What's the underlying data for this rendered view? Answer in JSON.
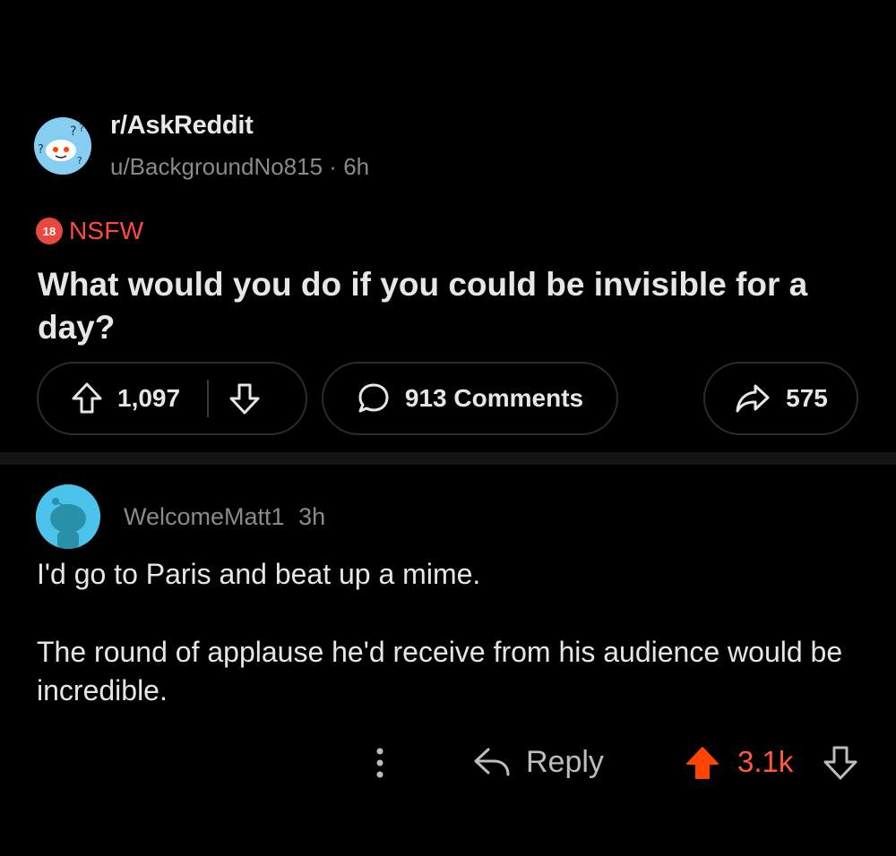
{
  "post": {
    "subreddit": "r/AskReddit",
    "author": "u/BackgroundNo815",
    "meta_separator": "·",
    "age": "6h",
    "nsfw_badge": "18",
    "nsfw_label": "NSFW",
    "title": "What would you do if you could be invisible for a day?",
    "upvotes": "1,097",
    "comments_label": "913 Comments",
    "shares": "575"
  },
  "comment": {
    "author": "WelcomeMatt1",
    "age": "3h",
    "paragraphs": [
      "I'd go to Paris and beat up a mime.",
      "The round of applause he'd receive from his audience would be incredible."
    ],
    "reply_label": "Reply",
    "score": "3.1k"
  },
  "colors": {
    "background": "#000000",
    "accent_nsfw": "#ff4a3d",
    "upvoted": "#ff5a36",
    "muted_text": "#8a8a8a",
    "pill_border": "#2b2b2b"
  },
  "icons": {
    "subreddit_avatar": "askreddit-snoo-icon",
    "upvote": "arrow-up-icon",
    "downvote": "arrow-down-icon",
    "comments": "speech-bubble-icon",
    "share": "share-arrow-icon",
    "more": "vertical-dots-icon",
    "reply": "reply-arrow-icon",
    "comment_avatar": "snoo-avatar-icon"
  }
}
